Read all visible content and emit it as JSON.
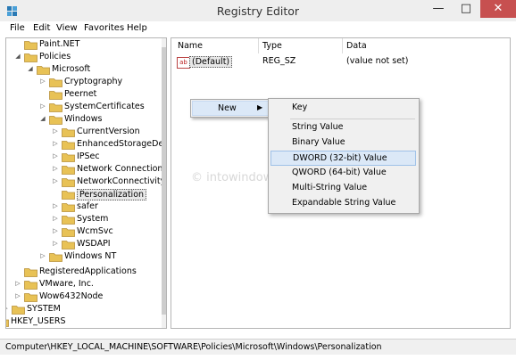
{
  "window": {
    "title": "Registry Editor",
    "minimize_glyph": "—",
    "maximize_glyph": "□",
    "close_glyph": "✕"
  },
  "menubar": {
    "file": "File",
    "edit": "Edit",
    "view": "View",
    "favorites": "Favorites",
    "help": "Help"
  },
  "tree": {
    "items": [
      {
        "label": "Paint.NET"
      },
      {
        "label": "Policies"
      },
      {
        "label": "Microsoft"
      },
      {
        "label": "Cryptography"
      },
      {
        "label": "Peernet"
      },
      {
        "label": "SystemCertificates"
      },
      {
        "label": "Windows"
      },
      {
        "label": "CurrentVersion"
      },
      {
        "label": "EnhancedStorageDevi"
      },
      {
        "label": "IPSec"
      },
      {
        "label": "Network Connections"
      },
      {
        "label": "NetworkConnectivityS"
      },
      {
        "label": "Personalization"
      },
      {
        "label": "safer"
      },
      {
        "label": "System"
      },
      {
        "label": "WcmSvc"
      },
      {
        "label": "WSDAPI"
      },
      {
        "label": "Windows NT"
      },
      {
        "label": "RegisteredApplications"
      },
      {
        "label": "VMware, Inc."
      },
      {
        "label": "Wow6432Node"
      },
      {
        "label": "SYSTEM"
      },
      {
        "label": "HKEY_USERS"
      }
    ]
  },
  "list": {
    "headers": {
      "name": "Name",
      "type": "Type",
      "data": "Data"
    },
    "rows": [
      {
        "icon": "ab",
        "name": "(Default)",
        "type": "REG_SZ",
        "data": "(value not set)"
      }
    ]
  },
  "context_menu": {
    "new_label": "New",
    "submenu": [
      "Key",
      "String Value",
      "Binary Value",
      "DWORD (32-bit) Value",
      "QWORD (64-bit) Value",
      "Multi-String Value",
      "Expandable String Value"
    ],
    "highlighted": "DWORD (32-bit) Value"
  },
  "watermark": "© intowindows.com",
  "status_bar": {
    "path": "Computer\\HKEY_LOCAL_MACHINE\\SOFTWARE\\Policies\\Microsoft\\Windows\\Personalization"
  },
  "colors": {
    "folder": "#e8c256",
    "close_button": "#c75050",
    "menu_highlight": "#dbe8f7"
  }
}
